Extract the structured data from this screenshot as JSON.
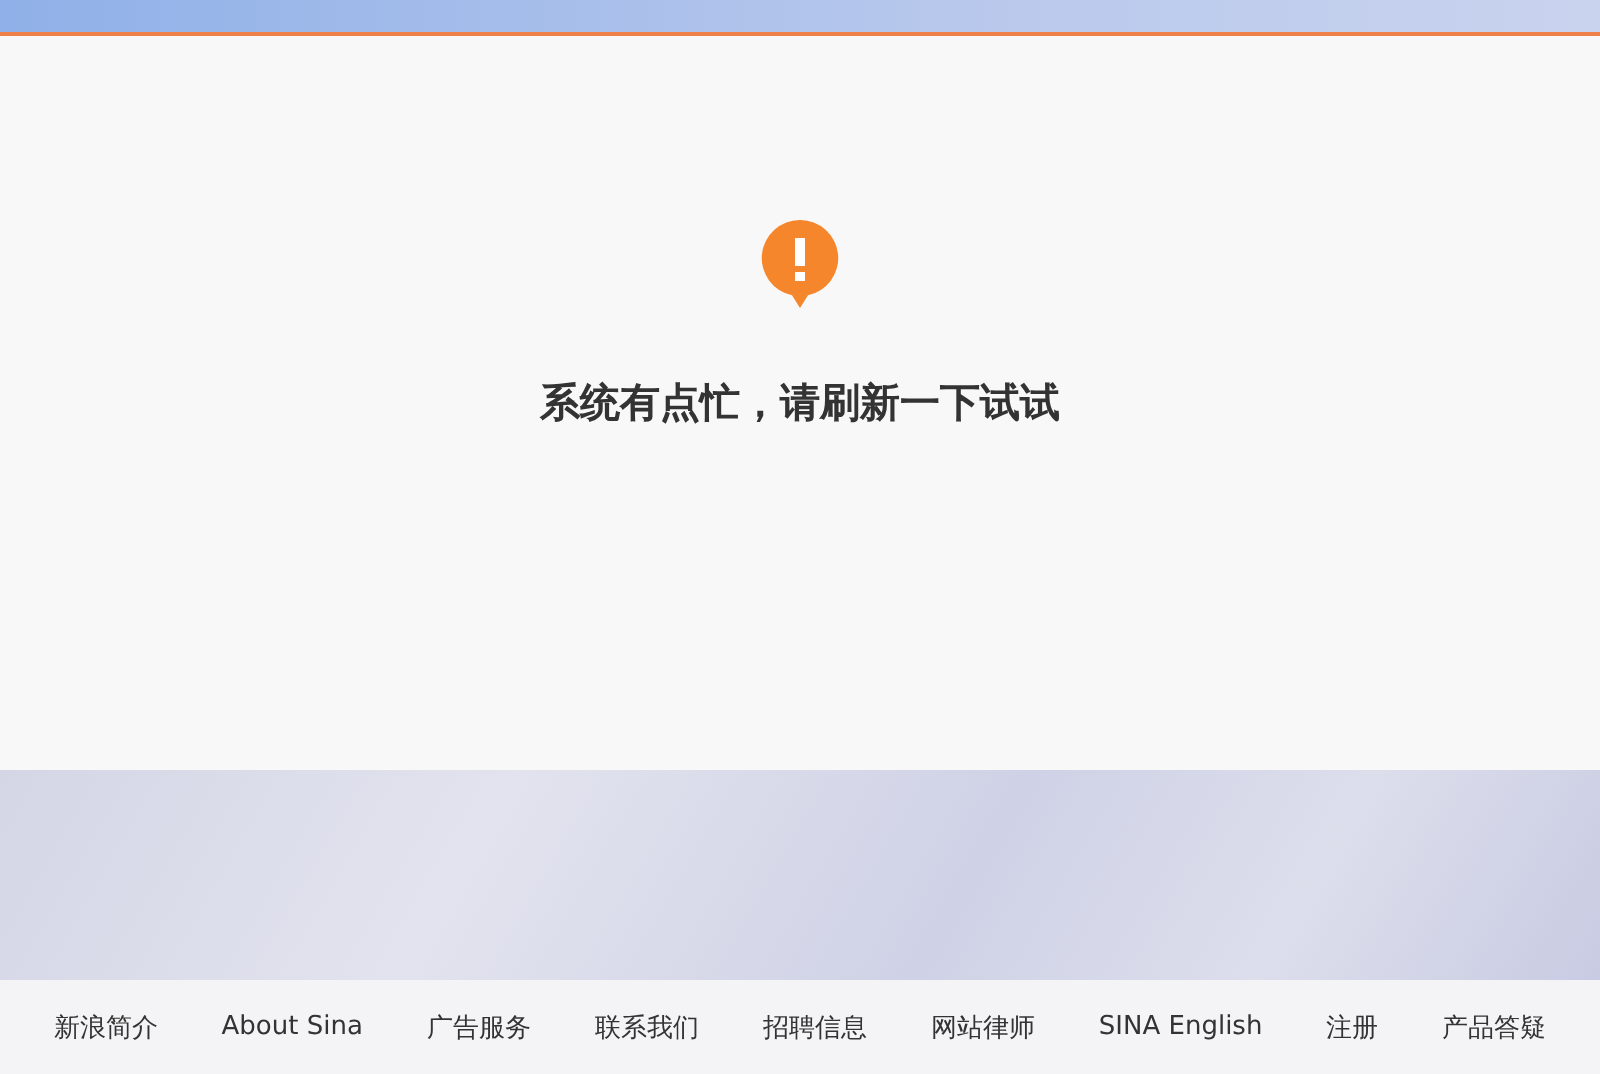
{
  "error": {
    "message": "系统有点忙，请刷新一下试试"
  },
  "footer": {
    "links": [
      "新浪简介",
      "About Sina",
      "广告服务",
      "联系我们",
      "招聘信息",
      "网站律师",
      "SINA English",
      "注册",
      "产品答疑"
    ]
  }
}
